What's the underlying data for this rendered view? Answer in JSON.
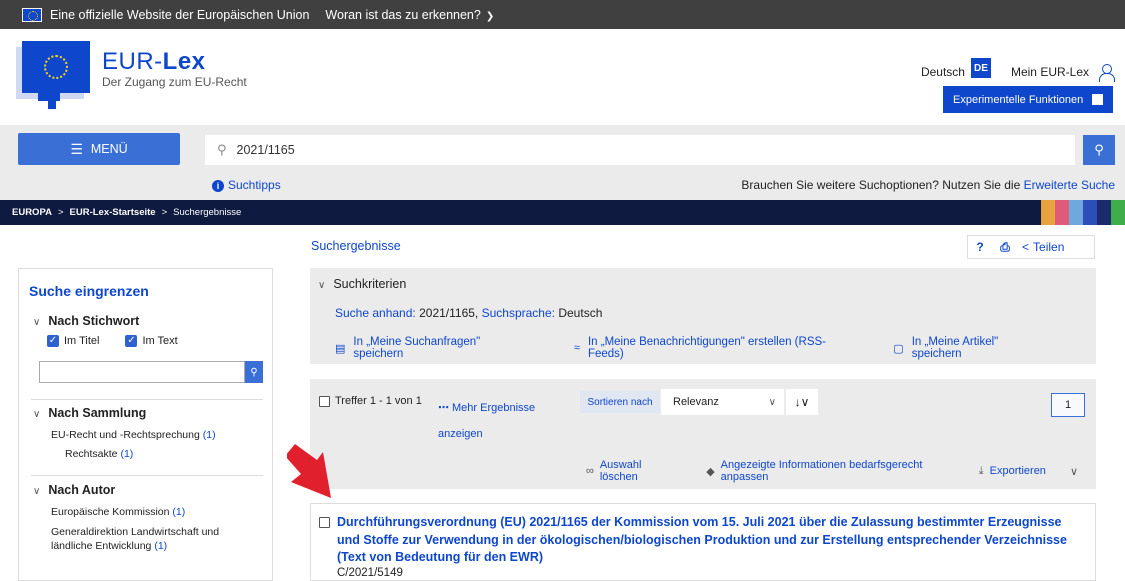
{
  "eu_bar": {
    "official_text": "Eine offizielle Website der Europäischen Union",
    "recognize_text": "Woran ist das zu erkennen?"
  },
  "header": {
    "logo_prefix": "EUR-",
    "logo_suffix": "Lex",
    "tagline": "Der Zugang zum EU-Recht",
    "language": "Deutsch",
    "language_code": "DE",
    "my_account": "Mein EUR-Lex",
    "experimental": "Experimentelle Funktionen"
  },
  "search": {
    "menu_label": "MENÜ",
    "query": "2021/1165",
    "tips": "Suchtipps",
    "advanced_prompt": "Brauchen Sie weitere Suchoptionen? Nutzen Sie die ",
    "advanced_link": "Erweiterte Suche"
  },
  "breadcrumb": [
    "EUROPA",
    "EUR-Lex-Startseite",
    "Suchergebnisse"
  ],
  "sidebar": {
    "title": "Suche eingrenzen",
    "keyword_section": "Nach Stichwort",
    "in_title": "Im Titel",
    "in_text": "Im Text",
    "collection_section": "Nach Sammlung",
    "collection_items": [
      {
        "label": "EU-Recht und -Rechtsprechung",
        "count": "(1)"
      },
      {
        "label": "Rechtsakte",
        "count": "(1)"
      }
    ],
    "author_section": "Nach Autor",
    "author_items": [
      {
        "label": "Europäische Kommission",
        "count": "(1)"
      },
      {
        "label_line1": "Generaldirektion Landwirtschaft und",
        "label_line2": "ländliche Entwicklung",
        "count": "(1)"
      }
    ]
  },
  "main": {
    "results_title": "Suchergebnisse",
    "share": "Teilen",
    "criteria_header": "Suchkriterien",
    "criteria_search_by": "Suche anhand:",
    "criteria_search_value": "2021/1165,",
    "criteria_lang_label": "Suchsprache:",
    "criteria_lang_value": "Deutsch",
    "save_query": "In „Meine Suchanfragen\" speichern",
    "create_alert": "In „Meine Benachrichtigungen\" erstellen (RSS-Feeds)",
    "save_article": "In „Meine Artikel\" speichern",
    "hits": "Treffer 1 - 1  von 1",
    "more_results_line1": "Mehr Ergebnisse",
    "more_results_line2": "anzeigen",
    "sort_by": "Sortieren nach",
    "sort_value": "Relevanz",
    "page": "1",
    "clear_selection": "Auswahl löschen",
    "customize": "Angezeigte Informationen bedarfsgerecht anpassen",
    "export": "Exportieren",
    "result_title": "Durchführungsverordnung (EU) 2021/1165 der Kommission vom 15. Juli 2021 über die Zulassung bestimmter Erzeugnisse und Stoffe zur Verwendung in der ökologischen/biologischen Produktion und zur Erstellung entsprechender Verzeichnisse (Text von Bedeutung für den EWR)",
    "result_id": "C/2021/5149"
  },
  "colors": {
    "brand_blue": "#0e47cb",
    "button_blue": "#3a6fd6",
    "arrow_red": "#e0202c",
    "breadcrumb_bg": "#0e1a3f"
  }
}
